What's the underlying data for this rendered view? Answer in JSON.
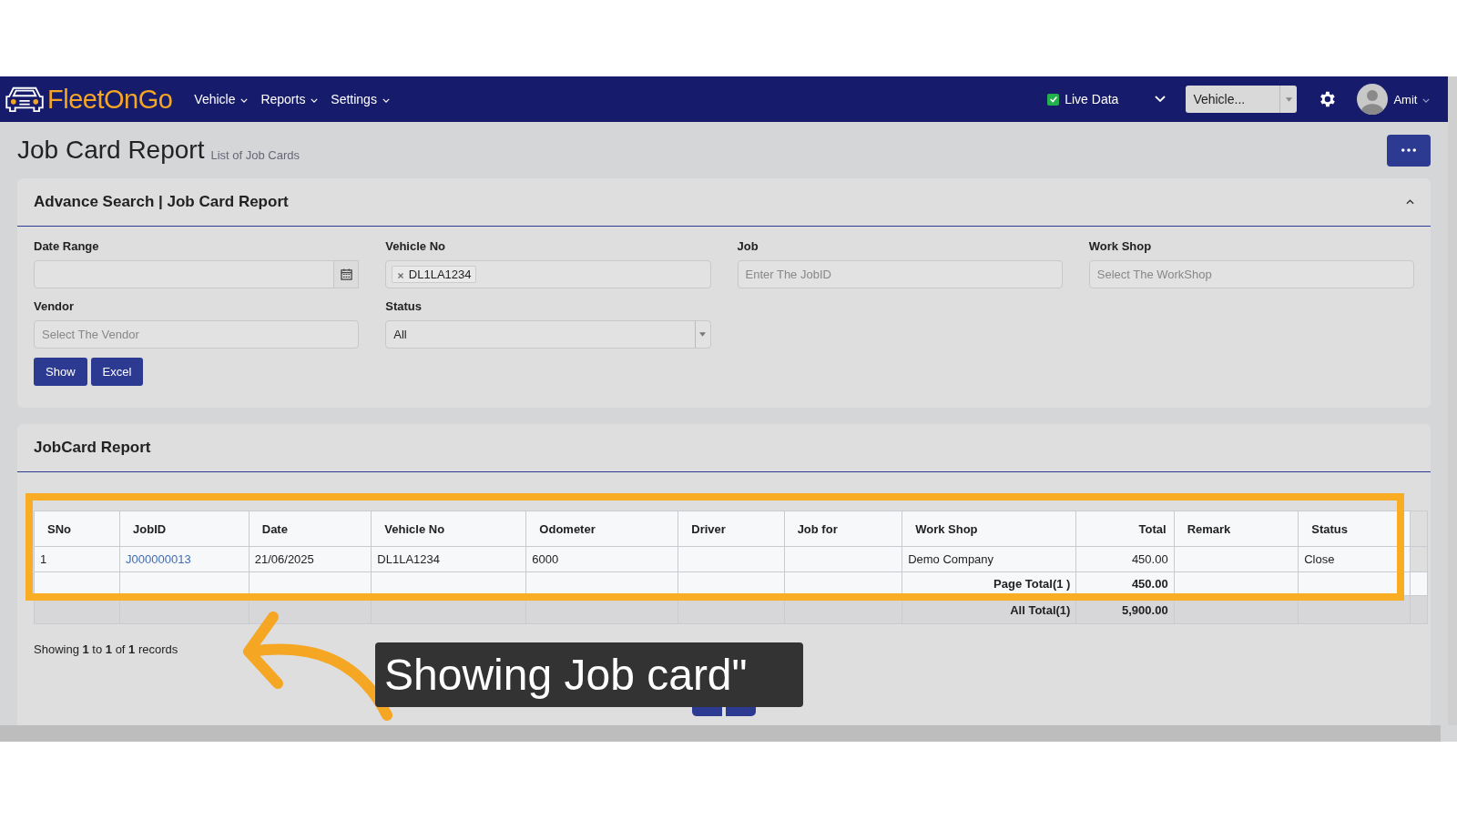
{
  "navbar": {
    "logo": "FleetOnGo",
    "menus": [
      "Vehicle",
      "Reports",
      "Settings"
    ],
    "live_data": {
      "label": "Live Data",
      "checked": true
    },
    "vehicle_select": {
      "value": "Vehicle..."
    },
    "user": {
      "name": "Amit"
    }
  },
  "page": {
    "title": "Job Card Report",
    "subtitle": "List of Job Cards"
  },
  "search_panel": {
    "title": "Advance Search | Job Card Report",
    "expanded": true,
    "fields": [
      {
        "kind": "date",
        "label": "Date Range"
      },
      {
        "kind": "tags",
        "label": "Vehicle No",
        "tags": [
          "DL1LA1234"
        ]
      },
      {
        "kind": "text",
        "label": "Job",
        "placeholder": "Enter The JobID"
      },
      {
        "kind": "search",
        "label": "Work Shop",
        "placeholder": "Select The WorkShop"
      },
      {
        "kind": "search",
        "label": "Vendor",
        "placeholder": "Select The Vendor"
      },
      {
        "kind": "select",
        "label": "Status",
        "value": "All"
      }
    ],
    "buttons": [
      "Show",
      "Excel"
    ]
  },
  "report": {
    "title": "JobCard Report",
    "columns": [
      {
        "label": "SNo",
        "kind": "text"
      },
      {
        "label": "JobID",
        "kind": "link"
      },
      {
        "label": "Date",
        "kind": "text"
      },
      {
        "label": "Vehicle No",
        "kind": "text"
      },
      {
        "label": "Odometer",
        "kind": "text"
      },
      {
        "label": "Driver",
        "kind": "text"
      },
      {
        "label": "Job for",
        "kind": "text"
      },
      {
        "label": "Work Shop",
        "kind": "text"
      },
      {
        "label": "Total",
        "kind": "amount"
      },
      {
        "label": "Remark",
        "kind": "text"
      },
      {
        "label": "Status",
        "kind": "text"
      }
    ],
    "rows": [
      [
        "1",
        "J000000013",
        "21/06/2025",
        "DL1LA1234",
        "6000",
        "",
        "",
        "Demo Company",
        "450.00",
        "",
        "Close"
      ]
    ],
    "page_total": {
      "label": "Page Total(1 )",
      "value": "450.00"
    },
    "all_total": {
      "label": "All Total(1)",
      "value": "5,900.00"
    },
    "info": "Showing **1** to **1** of **1** records",
    "pagination": [
      {
        "kind": "prev"
      },
      {
        "kind": "next"
      }
    ]
  },
  "annotation": {
    "text": "Showing Job card\""
  }
}
